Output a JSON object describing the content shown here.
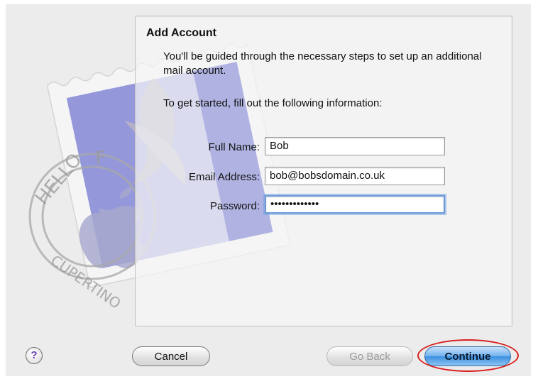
{
  "dialog": {
    "title": "Add Account",
    "intro": "You'll be guided through the necessary steps to set up an additional mail account.",
    "instruction": "To get started, fill out the following information:"
  },
  "form": {
    "full_name": {
      "label": "Full Name:",
      "value": "Bob"
    },
    "email": {
      "label": "Email Address:",
      "value": "bob@bobsdomain.co.uk"
    },
    "password": {
      "label": "Password:",
      "value": "•••••••••••••"
    }
  },
  "buttons": {
    "help": "?",
    "cancel": "Cancel",
    "go_back": "Go Back",
    "continue": "Continue"
  },
  "artwork": {
    "postmark_text_top": "HELLO FR",
    "postmark_text_bottom": "CUPERTINO, CA"
  },
  "colors": {
    "primary_button": "#3b8fe0",
    "highlight_ring": "#d81e1e",
    "stamp_fill": "#8e92d8"
  },
  "icons": [
    "help-icon",
    "mail-stamp-illustration",
    "apple-logo-icon",
    "eagle-illustration"
  ]
}
